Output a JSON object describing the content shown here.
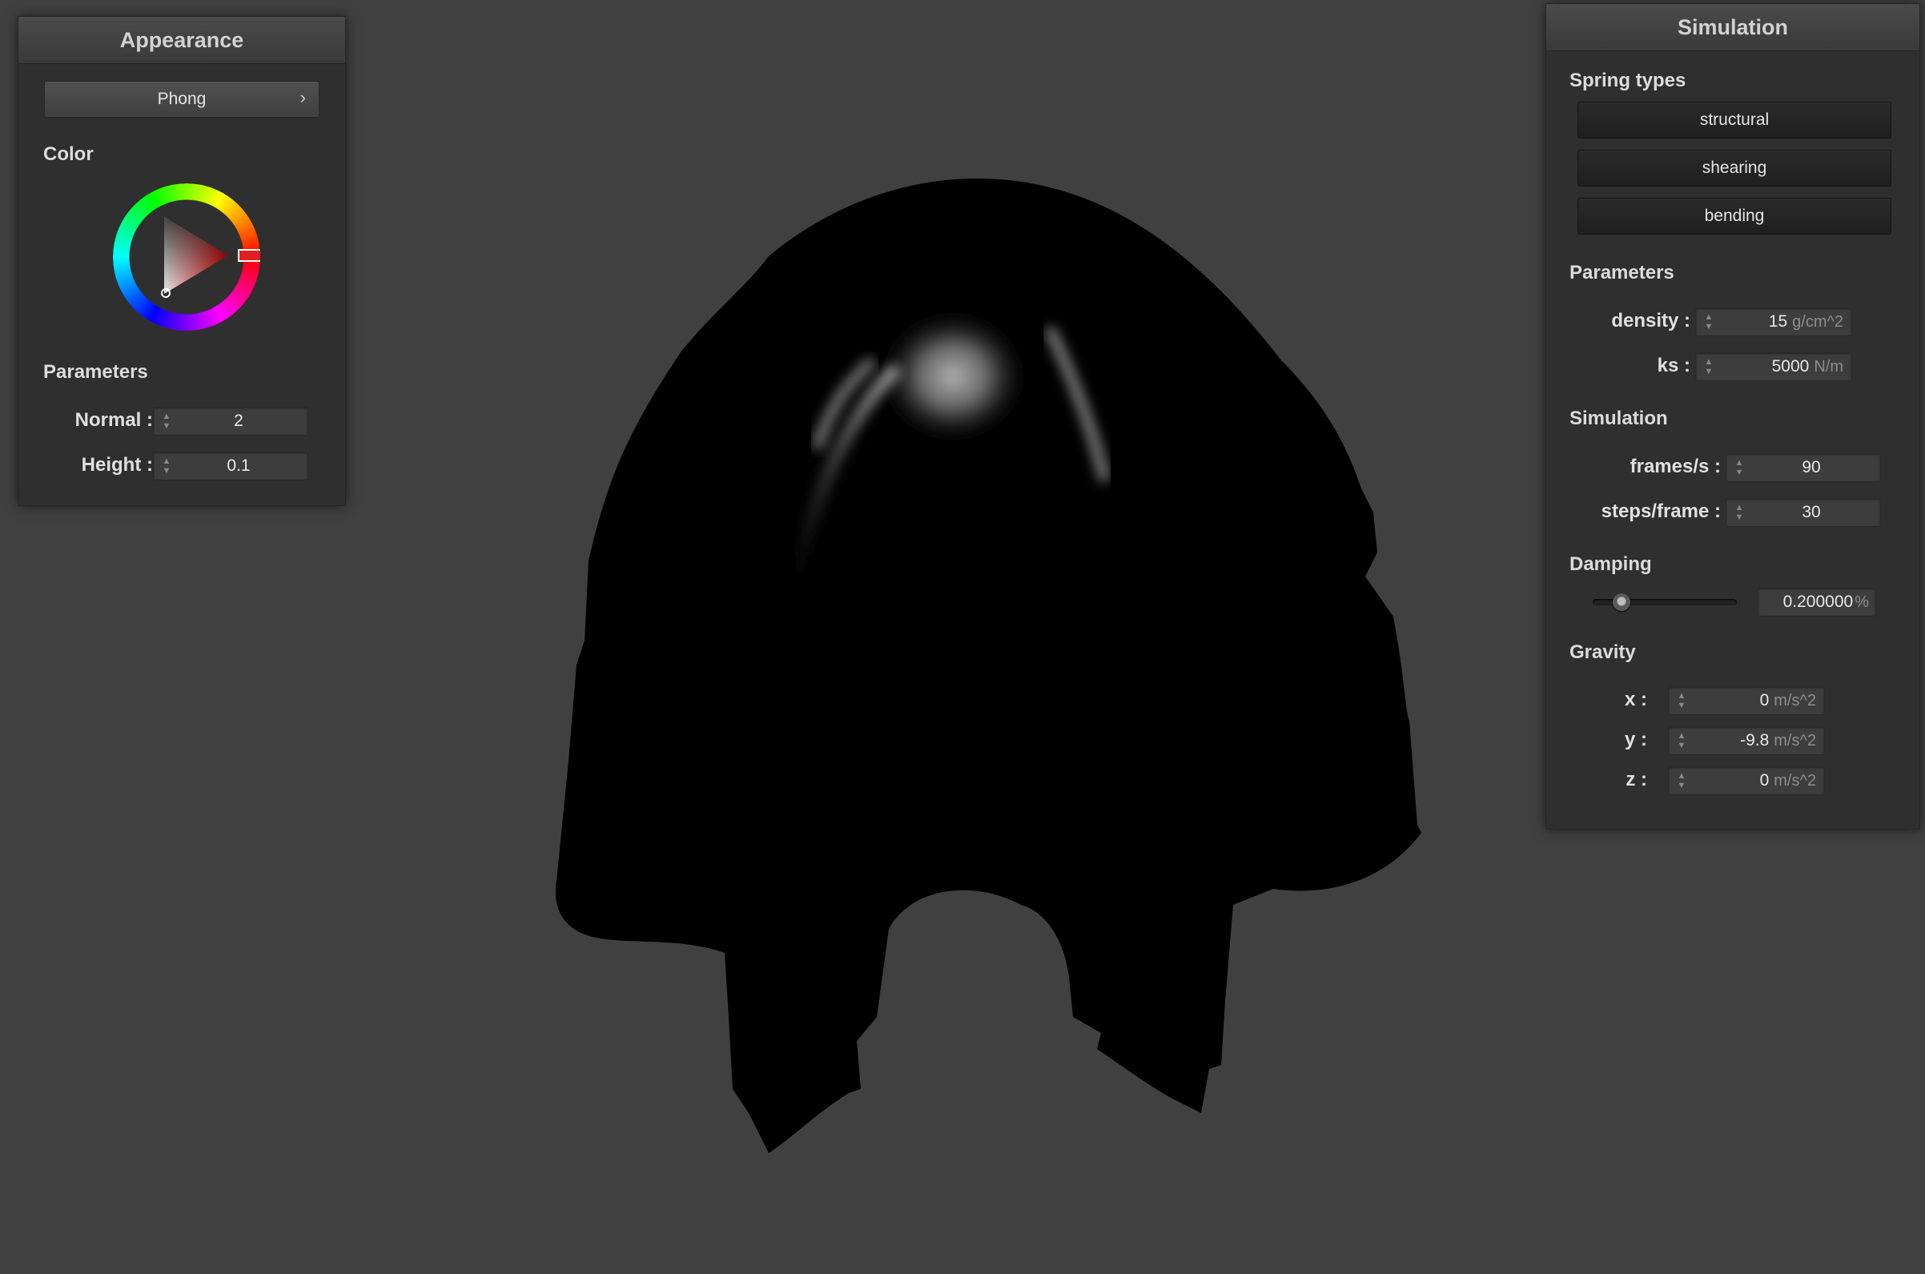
{
  "appearance": {
    "title": "Appearance",
    "shader": "Phong",
    "color_label": "Color",
    "params_label": "Parameters",
    "normal_label": "Normal :",
    "normal_value": "2",
    "height_label": "Height :",
    "height_value": "0.1",
    "selected_color": "#e02020"
  },
  "simulation": {
    "title": "Simulation",
    "spring_types_label": "Spring types",
    "spring_buttons": [
      "structural",
      "shearing",
      "bending"
    ],
    "params_label": "Parameters",
    "density_label": "density :",
    "density_value": "15",
    "density_unit": "g/cm^2",
    "ks_label": "ks :",
    "ks_value": "5000",
    "ks_unit": "N/m",
    "sim_label": "Simulation",
    "fps_label": "frames/s :",
    "fps_value": "90",
    "steps_label": "steps/frame :",
    "steps_value": "30",
    "damping_label": "Damping",
    "damping_value": "0.200000",
    "damping_unit": "%",
    "damping_fraction": 0.2,
    "gravity_label": "Gravity",
    "gx_label": "x :",
    "gx_value": "0",
    "gy_label": "y :",
    "gy_value": "-9.8",
    "gz_label": "z :",
    "gz_value": "0",
    "gravity_unit": "m/s^2"
  },
  "icons": {
    "spin_up": "chevron-up-icon",
    "spin_down": "chevron-down-icon",
    "dropdown": "chevron-right-icon"
  }
}
